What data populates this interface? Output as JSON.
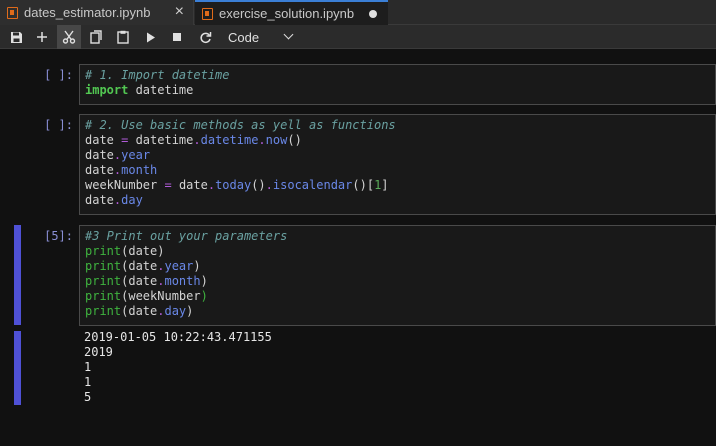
{
  "tabs": [
    {
      "label": "dates_estimator.ipynb",
      "action": "×"
    },
    {
      "label": "exercise_solution.ipynb",
      "action": "●"
    }
  ],
  "toolbar": {
    "save": "💾",
    "add": "+",
    "cut": "✂",
    "copy": "⧉",
    "paste": "📋",
    "run": "▶",
    "stop": "■",
    "restart": "↻",
    "cell_type": "Code"
  },
  "cells": [
    {
      "prompt": "[ ]:",
      "lines": [
        [
          {
            "t": "# 1. Import datetime",
            "c": "c-comment"
          }
        ],
        [
          {
            "t": "import",
            "c": "c-kw"
          },
          {
            "t": " datetime",
            "c": "c-name"
          }
        ]
      ]
    },
    {
      "prompt": "[ ]:",
      "lines": [
        [
          {
            "t": "# 2. Use basic methods as yell as functions",
            "c": "c-comment"
          }
        ],
        [
          {
            "t": "date ",
            "c": "c-name"
          },
          {
            "t": "=",
            "c": "c-op"
          },
          {
            "t": " datetime",
            "c": "c-name"
          },
          {
            "t": ".",
            "c": "c-op"
          },
          {
            "t": "datetime",
            "c": "c-attr"
          },
          {
            "t": ".",
            "c": "c-op"
          },
          {
            "t": "now",
            "c": "c-attr"
          },
          {
            "t": "()",
            "c": "c-paren"
          }
        ],
        [
          {
            "t": "date",
            "c": "c-name"
          },
          {
            "t": ".",
            "c": "c-op"
          },
          {
            "t": "year",
            "c": "c-attr"
          }
        ],
        [
          {
            "t": "date",
            "c": "c-name"
          },
          {
            "t": ".",
            "c": "c-op"
          },
          {
            "t": "month",
            "c": "c-attr"
          }
        ],
        [
          {
            "t": "weekNumber ",
            "c": "c-name"
          },
          {
            "t": "=",
            "c": "c-op"
          },
          {
            "t": " date",
            "c": "c-name"
          },
          {
            "t": ".",
            "c": "c-op"
          },
          {
            "t": "today",
            "c": "c-attr"
          },
          {
            "t": "()",
            "c": "c-paren"
          },
          {
            "t": ".",
            "c": "c-op"
          },
          {
            "t": "isocalendar",
            "c": "c-attr"
          },
          {
            "t": "()[",
            "c": "c-paren"
          },
          {
            "t": "1",
            "c": "c-num"
          },
          {
            "t": "]",
            "c": "c-paren"
          }
        ],
        [
          {
            "t": "date",
            "c": "c-name"
          },
          {
            "t": ".",
            "c": "c-op"
          },
          {
            "t": "day",
            "c": "c-attr"
          }
        ]
      ]
    },
    {
      "prompt": "[5]:",
      "lines": [
        [
          {
            "t": "#3 Print out your parameters",
            "c": "c-comment"
          }
        ],
        [
          {
            "t": "print",
            "c": "c-builtin"
          },
          {
            "t": "(date)",
            "c": "c-paren"
          }
        ],
        [
          {
            "t": "print",
            "c": "c-builtin"
          },
          {
            "t": "(date",
            "c": "c-paren"
          },
          {
            "t": ".",
            "c": "c-op"
          },
          {
            "t": "year",
            "c": "c-attr"
          },
          {
            "t": ")",
            "c": "c-paren"
          }
        ],
        [
          {
            "t": "print",
            "c": "c-builtin"
          },
          {
            "t": "(date",
            "c": "c-paren"
          },
          {
            "t": ".",
            "c": "c-op"
          },
          {
            "t": "month",
            "c": "c-attr"
          },
          {
            "t": ")",
            "c": "c-paren"
          }
        ],
        [
          {
            "t": "print",
            "c": "c-builtin"
          },
          {
            "t": "(weekNumber",
            "c": "c-paren"
          },
          {
            "t": ")",
            "c": "c-builtin"
          }
        ],
        [
          {
            "t": "print",
            "c": "c-builtin"
          },
          {
            "t": "(date",
            "c": "c-paren"
          },
          {
            "t": ".",
            "c": "c-op"
          },
          {
            "t": "day",
            "c": "c-attr"
          },
          {
            "t": ")",
            "c": "c-paren"
          }
        ]
      ]
    }
  ],
  "output": [
    "2019-01-05 10:22:43.471155",
    "2019",
    "1",
    "1",
    "5"
  ]
}
